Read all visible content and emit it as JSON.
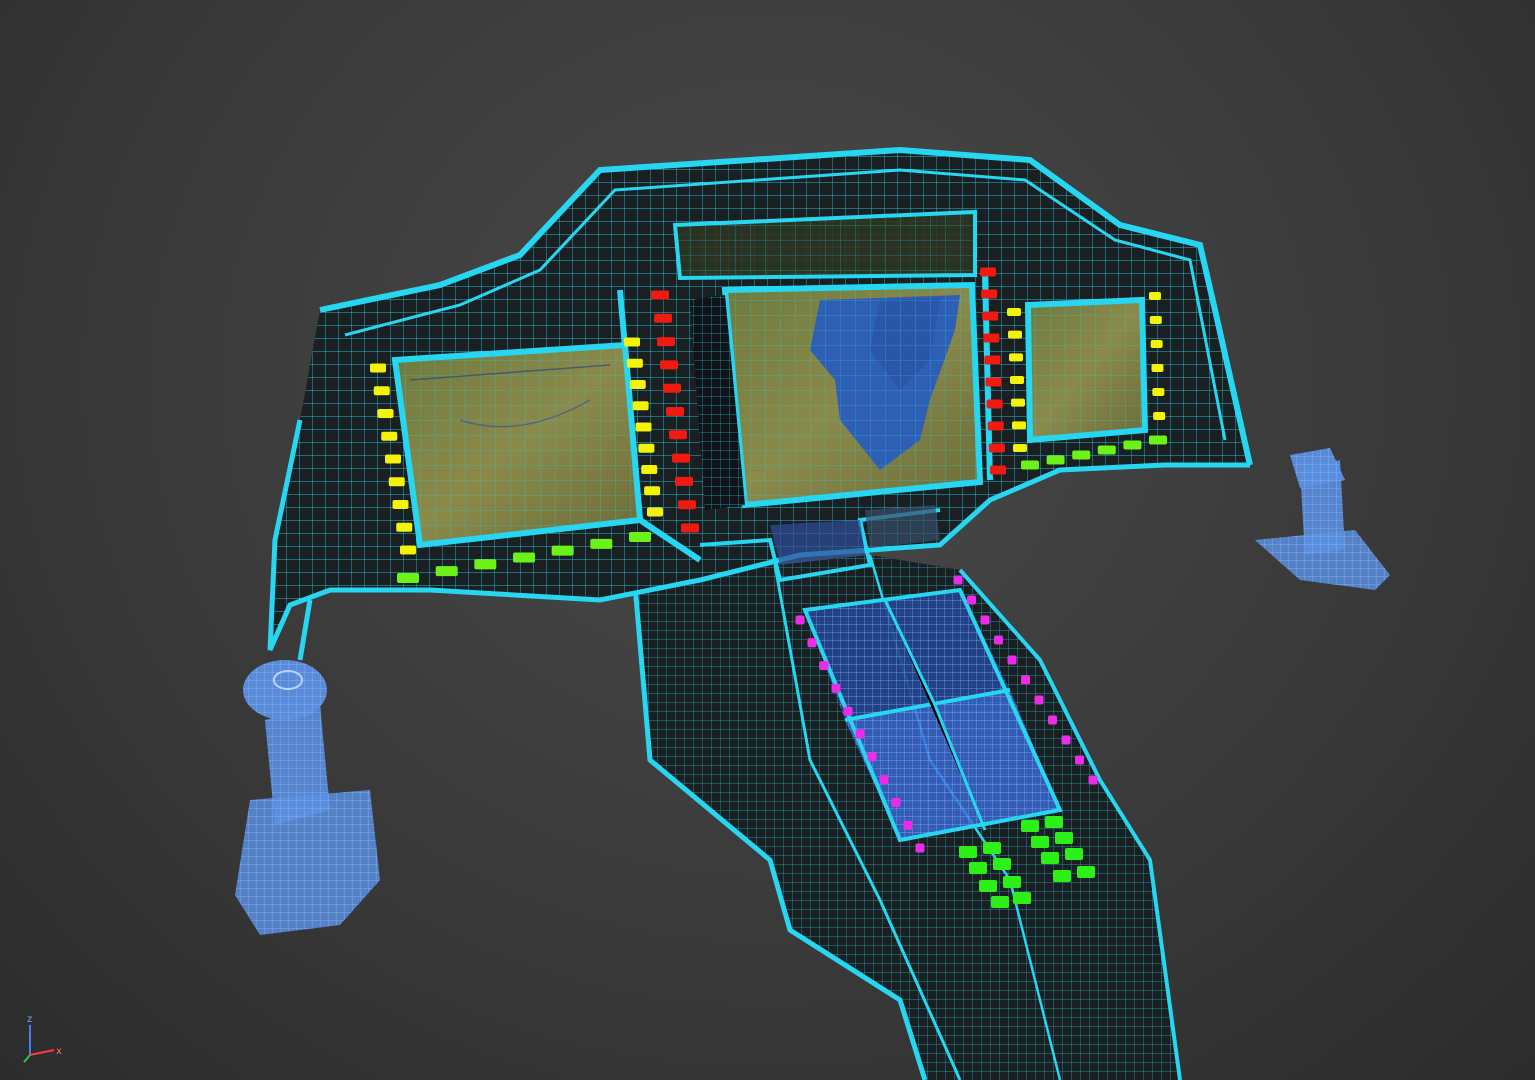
{
  "viewport": {
    "background": "#3c3c3c",
    "wire_color": "#27d6f0",
    "shell_fill": "#1a1f22",
    "joystick_color": "#5b8fe0"
  },
  "model": {
    "parts": [
      {
        "name": "instrument-panel",
        "type": "wireframe-mesh"
      },
      {
        "name": "center-console",
        "type": "wireframe-mesh"
      },
      {
        "name": "left-joystick",
        "type": "wireframe-mesh"
      },
      {
        "name": "right-joystick",
        "type": "wireframe-mesh"
      }
    ],
    "screens": [
      {
        "id": "upper-strip",
        "tint": "#4b5a3a"
      },
      {
        "id": "left-display",
        "tint": "#7a7a3e"
      },
      {
        "id": "center-display",
        "tint": "#8a8a56",
        "water": "#2e5fb5"
      },
      {
        "id": "right-display",
        "tint": "#7a7d42"
      },
      {
        "id": "console-upper",
        "tint": "#2f5fe0"
      },
      {
        "id": "console-lower",
        "tint": "#3a6ad8"
      }
    ],
    "button_rows": [
      {
        "color": "#f2f20a",
        "side": "left-display-left"
      },
      {
        "color": "#f2f20a",
        "side": "left-display-right"
      },
      {
        "color": "#6bf219",
        "side": "left-display-bottom"
      },
      {
        "color": "#f01a10",
        "side": "center-display-left"
      },
      {
        "color": "#f01a10",
        "side": "center-display-right"
      },
      {
        "color": "#f2f20a",
        "side": "right-display-left"
      },
      {
        "color": "#f2f20a",
        "side": "right-display-right"
      },
      {
        "color": "#6bf219",
        "side": "right-display-bottom"
      },
      {
        "color": "#ec2de8",
        "side": "console-left"
      },
      {
        "color": "#ec2de8",
        "side": "console-right"
      },
      {
        "color": "#2ef019",
        "side": "console-keypad"
      }
    ]
  },
  "gizmo": {
    "z_label": "z",
    "x_label": "x",
    "z_color": "#4a7bff",
    "x_color": "#ff3a3a",
    "y_color": "#3ac43a"
  }
}
